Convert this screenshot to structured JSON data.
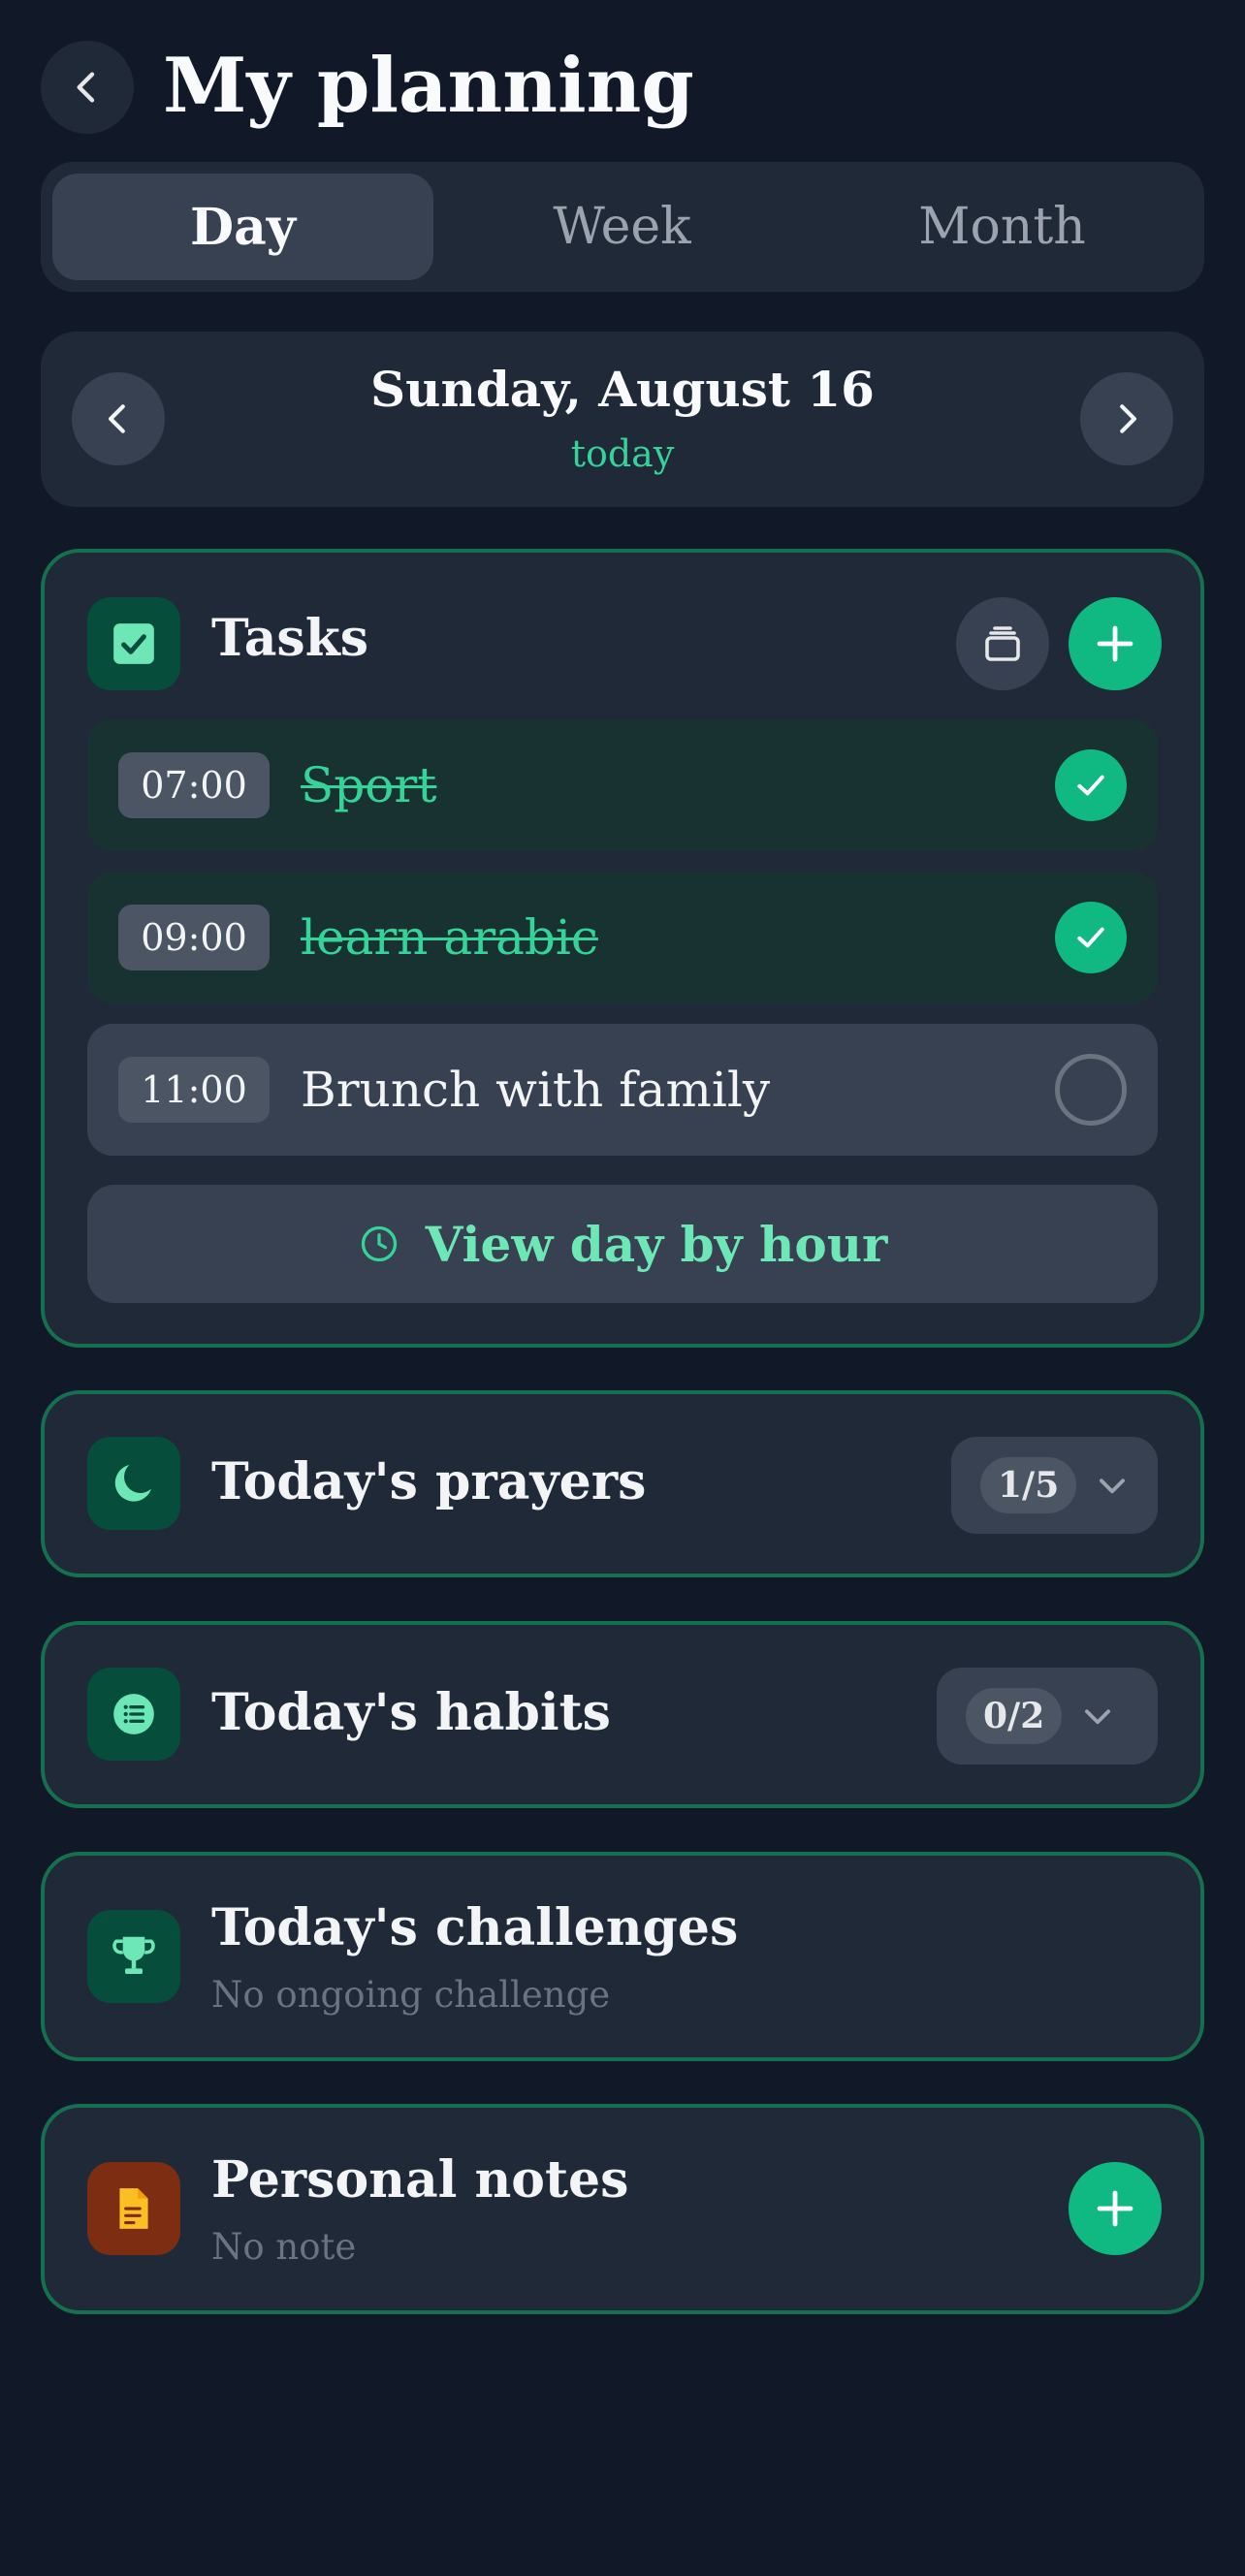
{
  "header": {
    "title": "My planning",
    "back_icon": "chevron-left-icon"
  },
  "tabs": [
    {
      "label": "Day",
      "active": true
    },
    {
      "label": "Week",
      "active": false
    },
    {
      "label": "Month",
      "active": false
    }
  ],
  "date_nav": {
    "date": "Sunday, August 16",
    "relative": "today"
  },
  "tasks": {
    "title": "Tasks",
    "items": [
      {
        "time": "07:00",
        "label": "Sport",
        "done": true
      },
      {
        "time": "09:00",
        "label": "learn arabic",
        "done": true
      },
      {
        "time": "11:00",
        "label": "Brunch with family",
        "done": false
      }
    ],
    "view_by_hour": "View day by hour"
  },
  "prayers": {
    "title": "Today's prayers",
    "count": "1/5"
  },
  "habits": {
    "title": "Today's habits",
    "count": "0/2"
  },
  "challenges": {
    "title": "Today's challenges",
    "subtitle": "No ongoing challenge"
  },
  "notes": {
    "title": "Personal notes",
    "subtitle": "No note"
  },
  "colors": {
    "background": "#111827",
    "card": "#1f2937",
    "accent": "#10b981",
    "accent_light": "#34d399",
    "border": "#14704f",
    "notes_icon_bg": "#7c2d12",
    "notes_icon": "#fbbf24"
  }
}
